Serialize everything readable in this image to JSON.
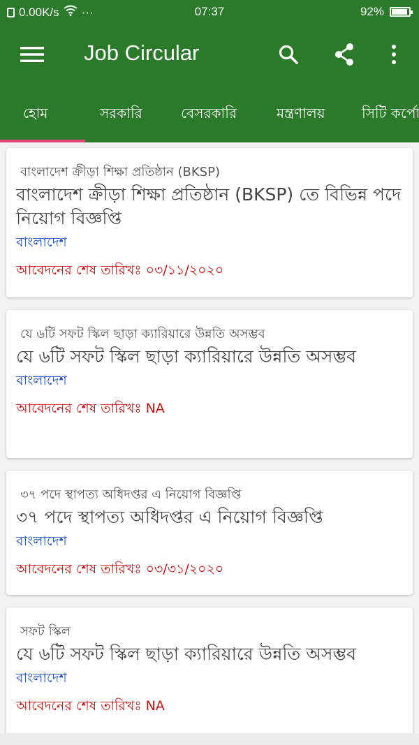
{
  "status_bar": {
    "network_speed": "0.00K/s",
    "more_dots": "···",
    "time": "07:37",
    "battery": "92%"
  },
  "app_bar": {
    "title": "Job Circular",
    "icons": [
      "menu-icon",
      "search-icon",
      "share-icon",
      "more-vert-icon"
    ]
  },
  "tabs": [
    {
      "label": "হোম",
      "selected": true
    },
    {
      "label": "সরকারি",
      "selected": false
    },
    {
      "label": "বেসরকারি",
      "selected": false
    },
    {
      "label": "মন্ত্রণালয়",
      "selected": false
    },
    {
      "label": "সিটি কর্পোরেশন",
      "selected": false
    }
  ],
  "colors": {
    "primary": "#2a7a2a",
    "tab_indicator": "#e8447a",
    "location_text": "#1f4fbf",
    "deadline_text": "#cc1111"
  },
  "cards": [
    {
      "category": "বাংলাদেশ ক্রীড়া শিক্ষা প্রতিষ্ঠান (BKSP)",
      "title": "বাংলাদেশ ক্রীড়া শিক্ষা প্রতিষ্ঠান (BKSP) তে বিভিন্ন পদে নিয়োগ বিজ্ঞপ্তি",
      "location": "বাংলাদেশ",
      "deadline": "আবেদনের শেষ তারিখঃ ০৩/১১/২০২০"
    },
    {
      "category": "যে ৬টি সফট স্কিল ছাড়া ক্যারিয়ারে উন্নতি অসম্ভব",
      "title": "যে ৬টি সফট স্কিল ছাড়া ক্যারিয়ারে উন্নতি অসম্ভব",
      "location": "বাংলাদেশ",
      "deadline": "আবেদনের শেষ তারিখঃ NA"
    },
    {
      "category": "৩৭ পদে স্থাপত্য অধিদপ্তর এ নিয়োগ বিজ্ঞপ্তি",
      "title": "৩৭ পদে স্থাপত্য অধিদপ্তর এ নিয়োগ বিজ্ঞপ্তি",
      "location": "বাংলাদেশ",
      "deadline": "আবেদনের শেষ তারিখঃ ০৩/৩১/২০২০"
    },
    {
      "category": "সফট স্কিল",
      "title": "যে ৬টি সফট স্কিল ছাড়া ক্যারিয়ারে উন্নতি অসম্ভব",
      "location": "বাংলাদেশ",
      "deadline": "আবেদনের শেষ তারিখঃ NA"
    }
  ]
}
